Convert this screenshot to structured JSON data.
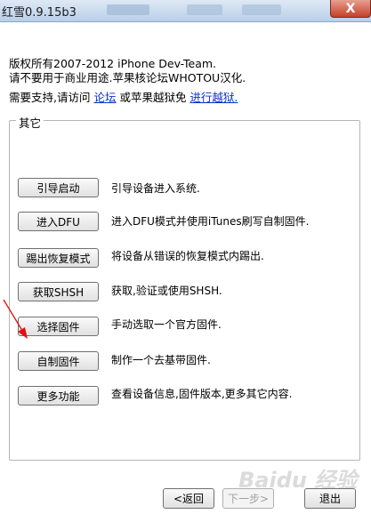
{
  "window": {
    "title": "红雪0.9.15b3",
    "close_glyph": "X"
  },
  "intro": {
    "line1": "版权所有2007-2012 iPhone Dev-Team.",
    "line2": "请不要用于商业用途.苹果核论坛WHOTOU汉化.",
    "line3_prefix": "需要支持,请访问 ",
    "link_forum": "论坛",
    "line3_middle": " 或苹果越狱免 ",
    "link_jailbreak": "进行越狱."
  },
  "group": {
    "label": "其它",
    "items": [
      {
        "button": "引导启动",
        "desc": "引导设备进入系统."
      },
      {
        "button": "进入DFU",
        "desc": "进入DFU模式并使用iTunes刷写自制固件."
      },
      {
        "button": "踢出恢复模式",
        "desc": "将设备从错误的恢复模式内踢出."
      },
      {
        "button": "获取SHSH",
        "desc": "获取,验证或使用SHSH."
      },
      {
        "button": "选择固件",
        "desc": "手动选取一个官方固件."
      },
      {
        "button": "自制固件",
        "desc": "制作一个去基带固件."
      },
      {
        "button": "更多功能",
        "desc": "查看设备信息,固件版本,更多其它内容."
      }
    ]
  },
  "footer": {
    "back": "<返回",
    "next": "下一步>",
    "exit": "退出"
  },
  "watermark": "Baidu 经验",
  "colors": {
    "link": "#0b30c8",
    "arrow": "#e01010"
  }
}
